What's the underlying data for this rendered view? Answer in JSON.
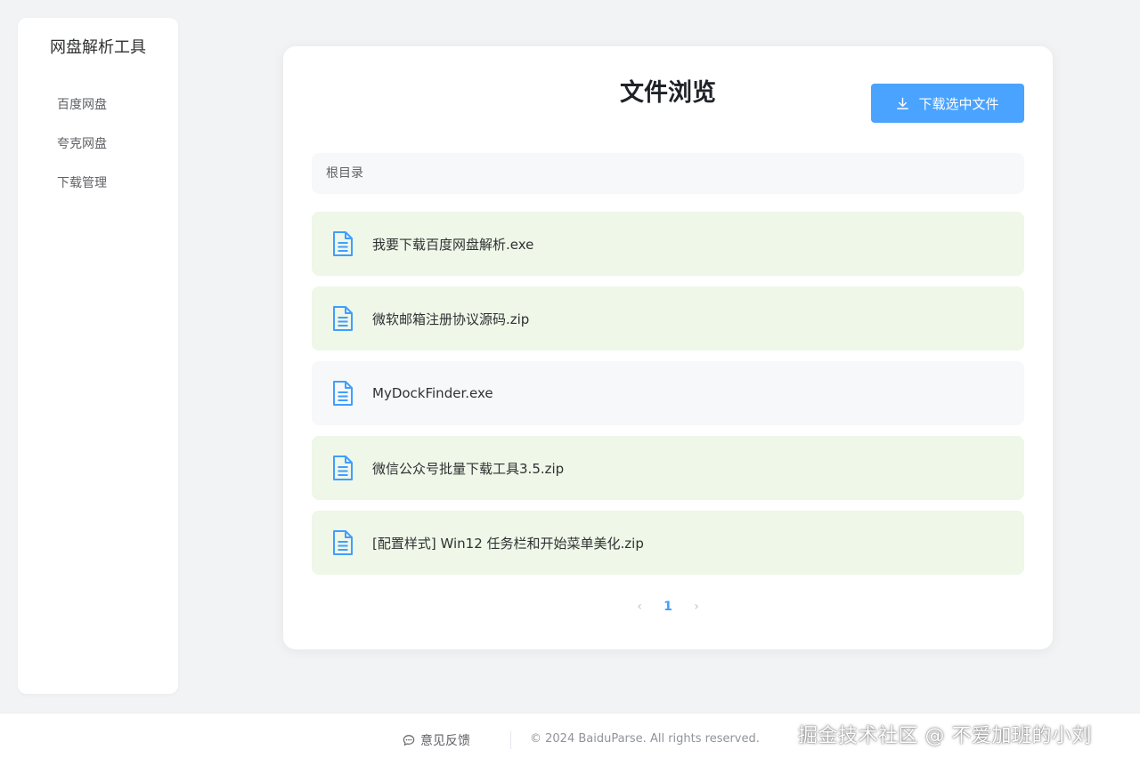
{
  "sidebar": {
    "brand": "网盘解析工具",
    "items": [
      {
        "label": "百度网盘"
      },
      {
        "label": "夸克网盘"
      },
      {
        "label": "下载管理"
      }
    ]
  },
  "panel": {
    "title": "文件浏览",
    "download_label": "下载选中文件",
    "breadcrumb": "根目录",
    "files": [
      {
        "name": "我要下载百度网盘解析.exe",
        "selected": true,
        "icon": "file-doc-icon"
      },
      {
        "name": "微软邮箱注册协议源码.zip",
        "selected": true,
        "icon": "file-doc-icon"
      },
      {
        "name": "MyDockFinder.exe",
        "selected": false,
        "icon": "file-doc-icon"
      },
      {
        "name": "微信公众号批量下载工具3.5.zip",
        "selected": true,
        "icon": "file-doc-icon"
      },
      {
        "name": "[配置样式] Win12 任务栏和开始菜单美化.zip",
        "selected": true,
        "icon": "file-doc-icon"
      }
    ],
    "pagination": {
      "prev": "‹",
      "current": "1",
      "next": "›"
    }
  },
  "footer": {
    "feedback": "意见反馈",
    "copyright": "© 2024 BaiduParse. All rights reserved."
  },
  "watermark": "掘金技术社区 @ 不爱加班的小刘",
  "colors": {
    "accent": "#4aa3ff",
    "selected_row": "#eef7e8",
    "plain_row": "#f7f8fa",
    "icon_blue": "#409eff"
  }
}
